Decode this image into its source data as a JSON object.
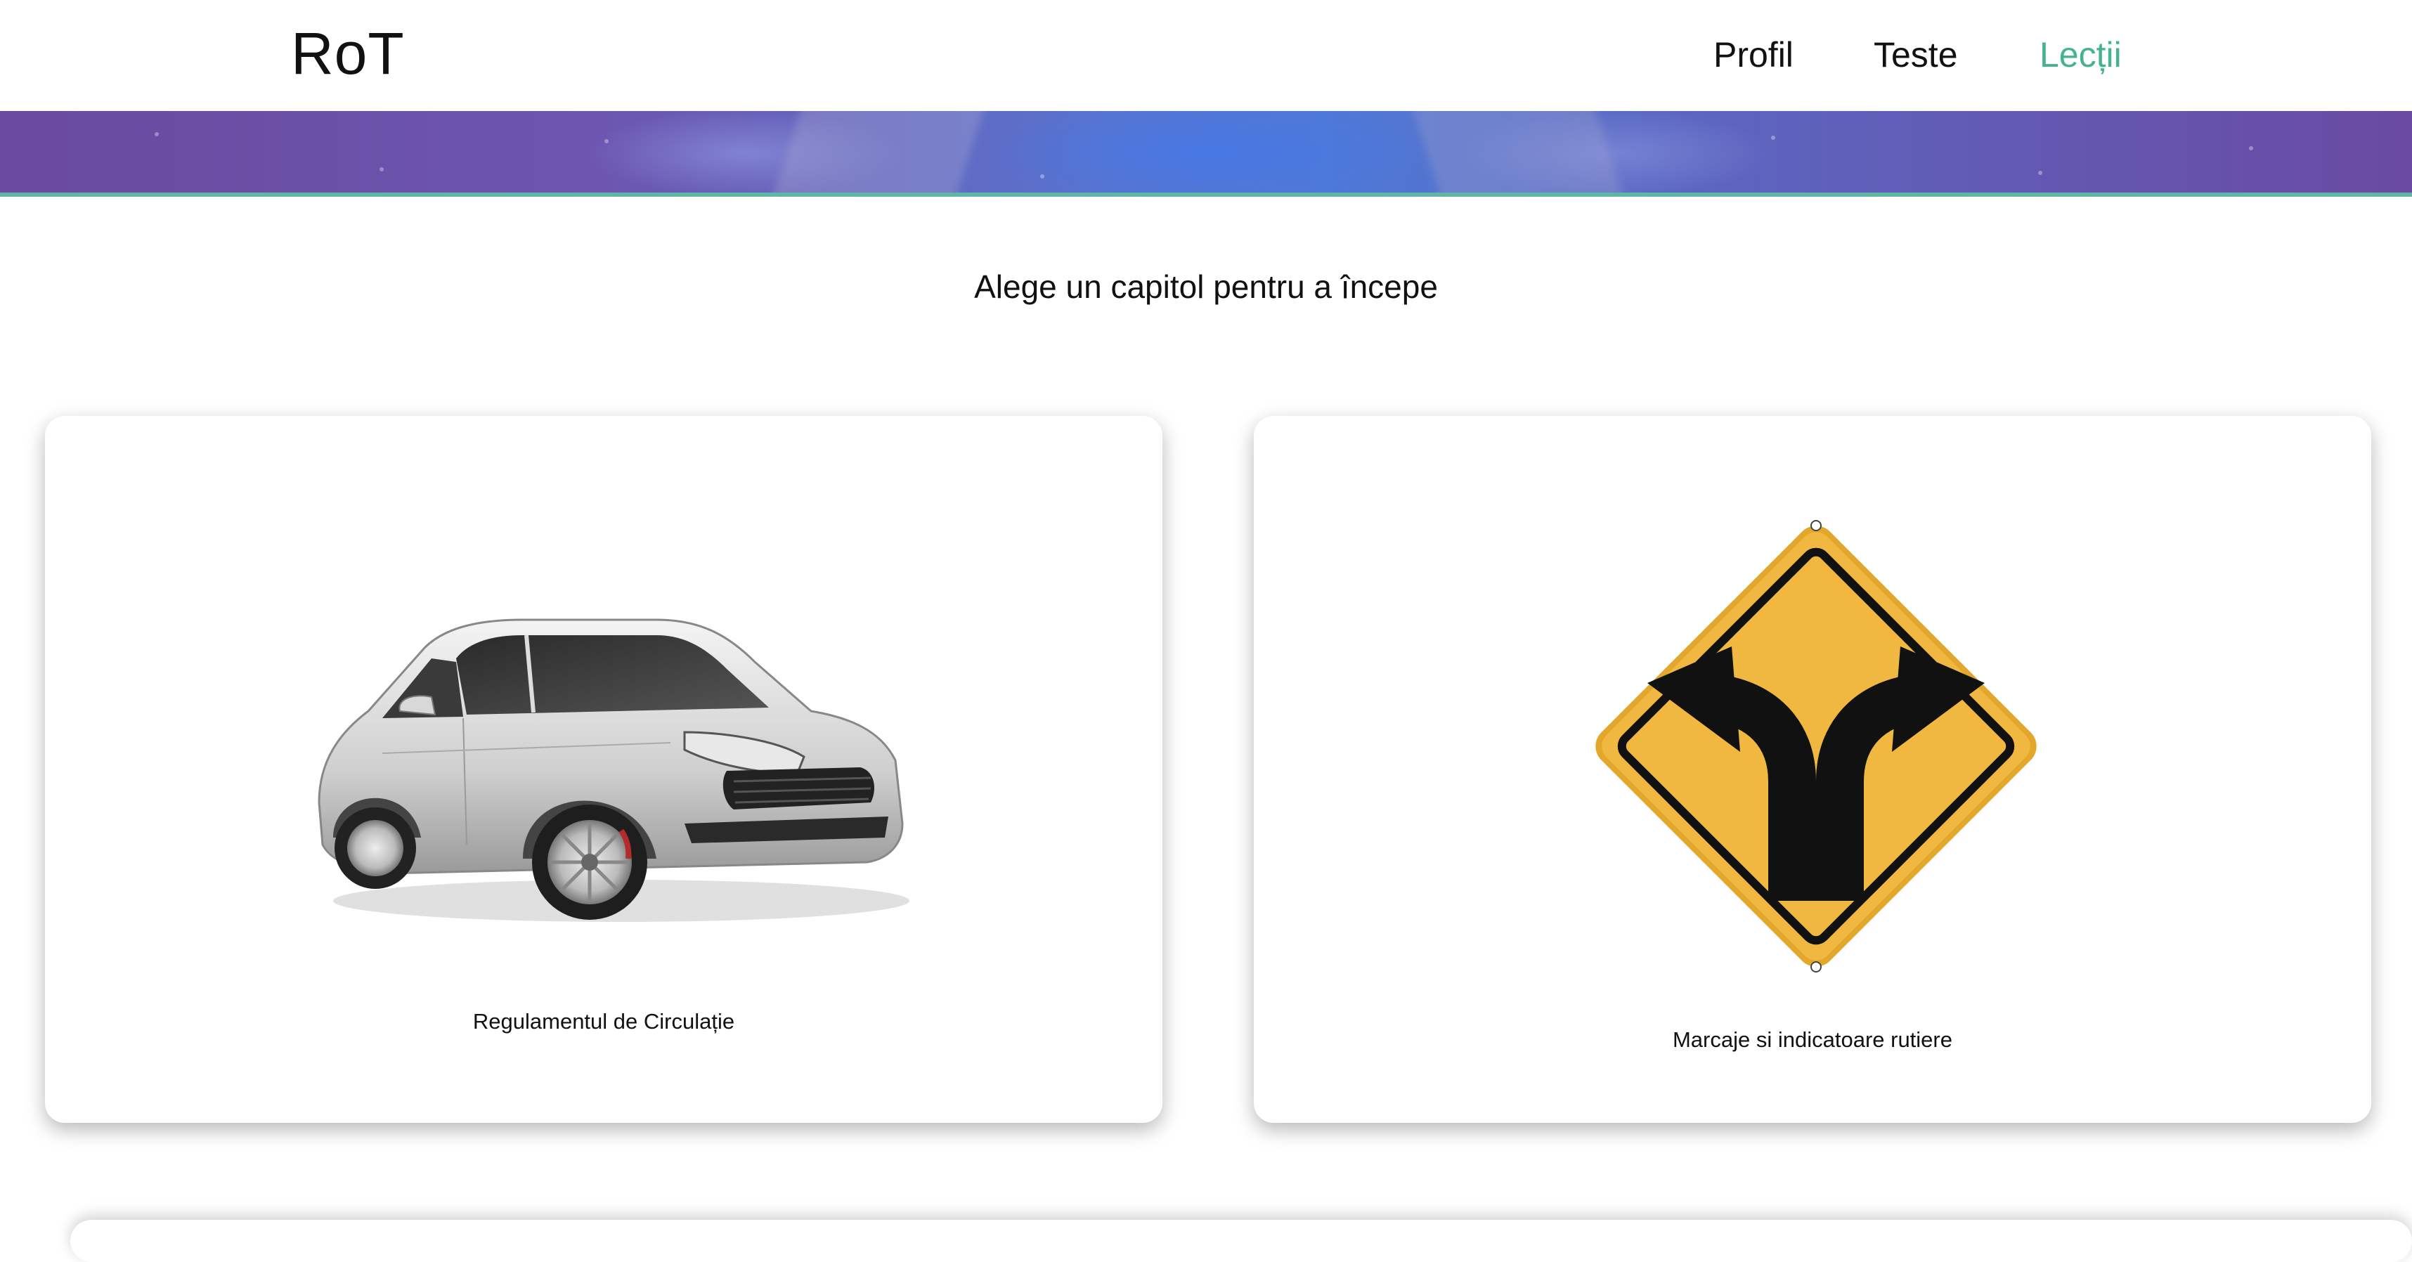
{
  "header": {
    "logo": "RoT",
    "nav": [
      {
        "label": "Profil",
        "active": false
      },
      {
        "label": "Teste",
        "active": false
      },
      {
        "label": "Lecții",
        "active": true
      }
    ],
    "active_color": "#45b38d"
  },
  "main": {
    "subtitle": "Alege un capitol pentru a începe",
    "cards": [
      {
        "label": "Regulamentul de Circulație",
        "image": "car-image"
      },
      {
        "label": "Marcaje si indicatoare rutiere",
        "image": "fork-road-sign-image"
      }
    ]
  },
  "colors": {
    "banner_line": "#5fb6a6",
    "sign_yellow": "#f0b840"
  }
}
